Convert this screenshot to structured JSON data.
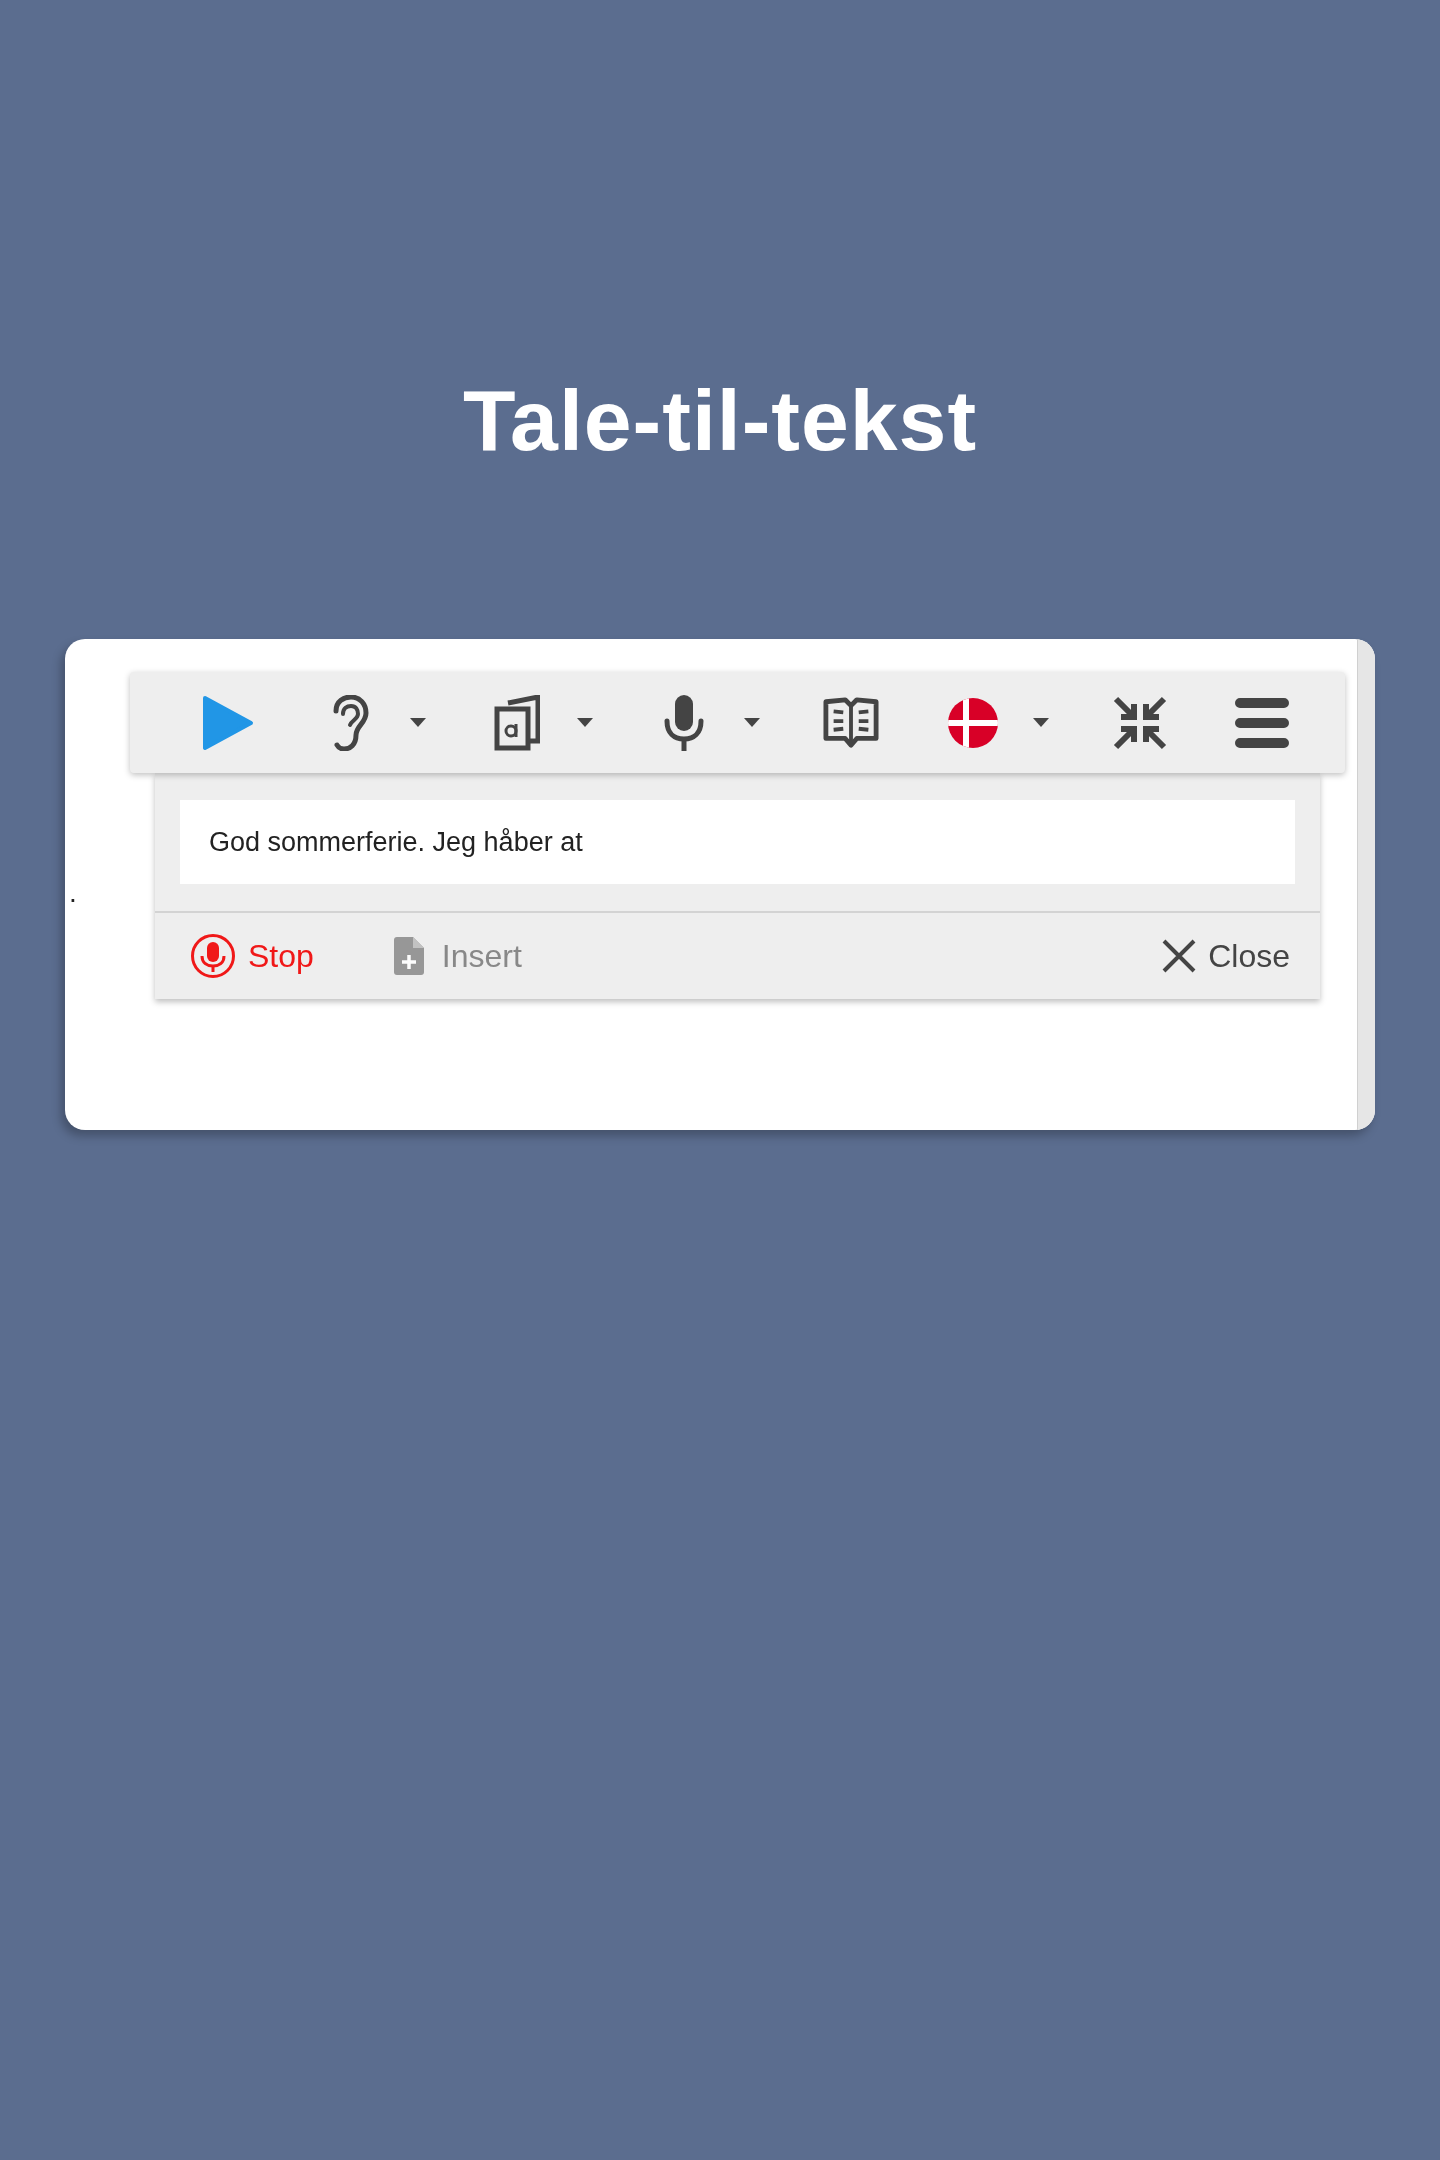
{
  "title": "Tale-til-tekst",
  "document": {
    "fragment": "."
  },
  "toolbar": {
    "buttons": [
      {
        "kind": "play",
        "dropdown": false
      },
      {
        "kind": "listen",
        "dropdown": true
      },
      {
        "kind": "screen-reader",
        "dropdown": true
      },
      {
        "kind": "microphone",
        "dropdown": true
      },
      {
        "kind": "dictionary",
        "dropdown": false
      },
      {
        "kind": "language",
        "dropdown": true
      },
      {
        "kind": "collapse",
        "dropdown": false
      },
      {
        "kind": "menu",
        "dropdown": false
      }
    ]
  },
  "dictation": {
    "value": "God sommerferie. Jeg håber at",
    "actions": [
      {
        "kind": "stop",
        "label": "Stop",
        "disabled": false
      },
      {
        "kind": "insert",
        "label": "Insert",
        "disabled": true
      },
      {
        "kind": "close",
        "label": "Close",
        "disabled": false
      }
    ]
  }
}
